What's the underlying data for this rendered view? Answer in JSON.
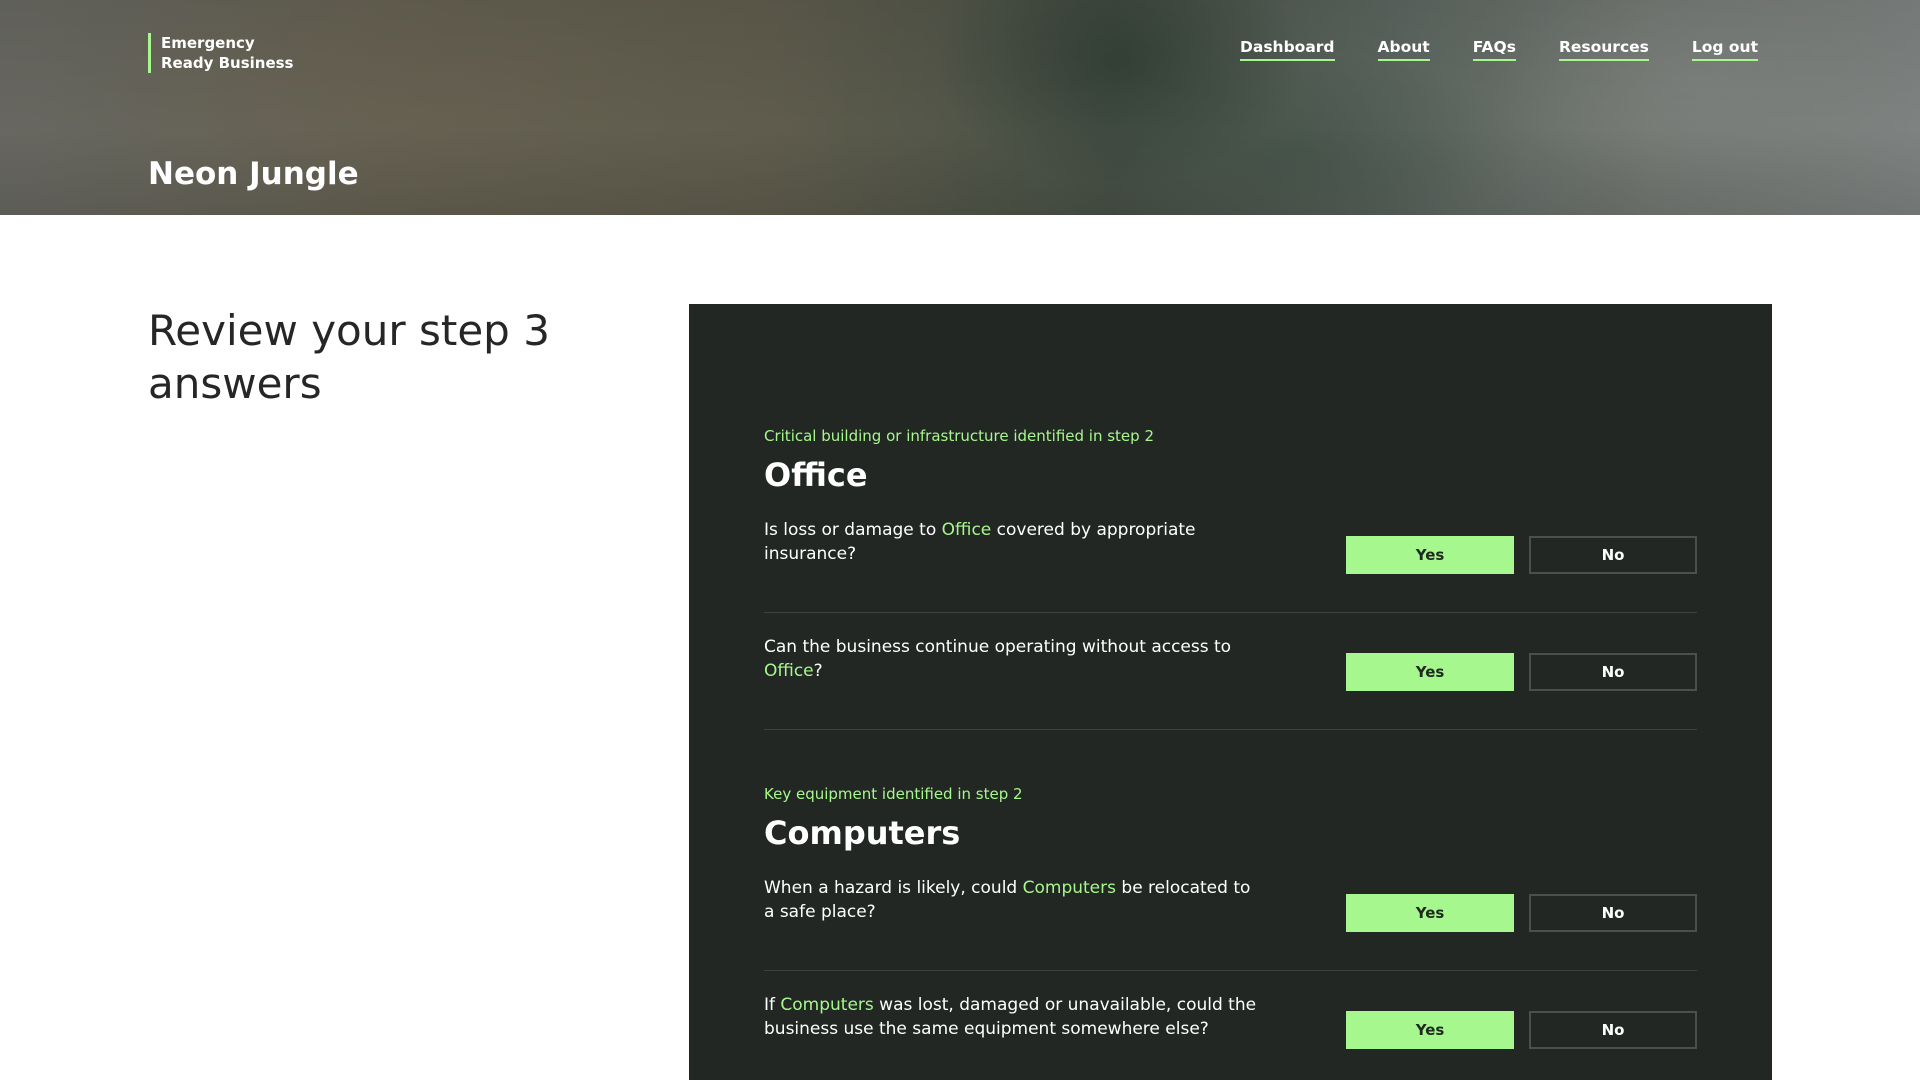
{
  "header": {
    "logo_line1": "Emergency",
    "logo_line2": "Ready Business",
    "nav": [
      "Dashboard",
      "About",
      "FAQs",
      "Resources",
      "Log out"
    ],
    "business_name": "Neon Jungle"
  },
  "main": {
    "title": "Review your step 3 answers"
  },
  "colors": {
    "accent": "#a6f78d",
    "panel_bg": "#222724",
    "text_dark": "#262626"
  },
  "sections": [
    {
      "kicker": "Critical building or infrastructure identified in step 2",
      "title": "Office",
      "questions": [
        {
          "before": "Is loss or damage to ",
          "highlight": "Office",
          "after": " covered by appropriate insurance?",
          "yes_label": "Yes",
          "no_label": "No",
          "selected": "Yes"
        },
        {
          "before": "Can the business continue operating without access to ",
          "highlight": "Office",
          "after": "?",
          "yes_label": "Yes",
          "no_label": "No",
          "selected": "Yes"
        }
      ]
    },
    {
      "kicker": "Key equipment identified in step 2",
      "title": "Computers",
      "questions": [
        {
          "before": "When a hazard is likely, could ",
          "highlight": "Computers",
          "after": " be relocated to a safe place?",
          "yes_label": "Yes",
          "no_label": "No",
          "selected": "Yes"
        },
        {
          "before": "If ",
          "highlight": "Computers",
          "after": " was lost, damaged or unavailable, could the business use the same equipment somewhere else?",
          "yes_label": "Yes",
          "no_label": "No",
          "selected": "Yes"
        }
      ]
    }
  ]
}
